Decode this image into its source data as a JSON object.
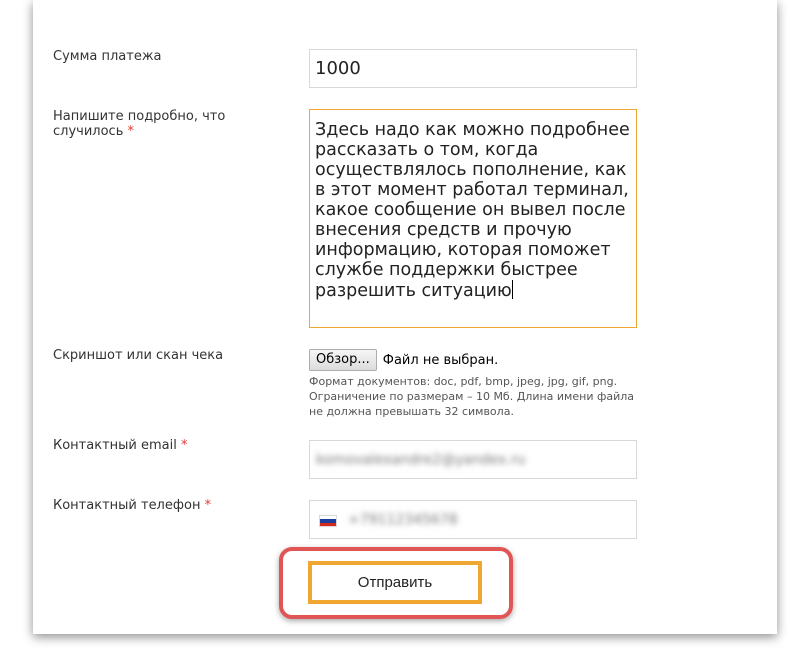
{
  "form": {
    "amount": {
      "label": "Сумма платежа",
      "value": "1000"
    },
    "description": {
      "label": "Напишите подробно, что случилось",
      "required_mark": "*",
      "value": "Здесь надо как можно подробнее рассказать о том, когда осуществлялось пополнение, как в этот момент работал терминал, какое сообщение он вывел после внесения средств и прочую информацию, которая поможет службе поддержки быстрее разрешить ситуацию"
    },
    "attachment": {
      "label": "Скриншот или скан чека",
      "browse_label": "Обзор...",
      "status": "Файл не выбран.",
      "hint": "Формат документов: doc, pdf, bmp, jpeg, jpg, gif, png. Ограничение по размерам – 10 Мб. Длина имени файла не должна превышать 32 символа."
    },
    "email": {
      "label": "Контактный email",
      "required_mark": "*",
      "value": "komovalexandre2@yandex.ru"
    },
    "phone": {
      "label": "Контактный телефон",
      "required_mark": "*",
      "flag_icon": "russia-flag-icon",
      "value": "+79112345678"
    },
    "submit_label": "Отправить"
  },
  "colors": {
    "accent_orange": "#f0a732",
    "required_red": "#e53935",
    "highlight_red": "#e05555"
  }
}
